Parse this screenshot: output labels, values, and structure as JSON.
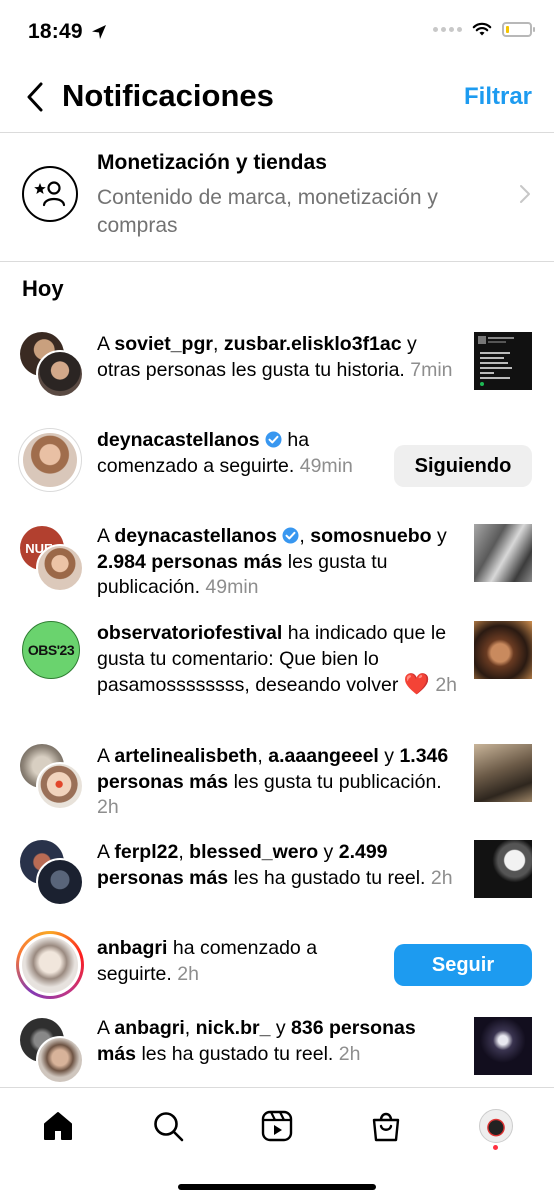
{
  "status": {
    "time": "18:49"
  },
  "header": {
    "title": "Notificaciones",
    "filter_label": "Filtrar"
  },
  "monetization": {
    "title": "Monetización y tiendas",
    "subtitle": "Contenido de marca, monetización y compras"
  },
  "section_today": "Hoy",
  "notifications": [
    {
      "pre": "A ",
      "u1": "soviet_pgr",
      "sep1": ", ",
      "u2": "zusbar.elisklo3f1ac",
      "post": " y otras personas les gusta tu historia.",
      "time": "7min"
    },
    {
      "u1": "deynacastellanos",
      "post": " ha comenzado a seguirte.",
      "time": "49min",
      "button": "Siguiendo"
    },
    {
      "pre": "A ",
      "u1": "deynacastellanos",
      "sep1": ", ",
      "u2": "somosnuebo",
      "sep2": " y ",
      "u3": "2.984 personas más",
      "post": " les gusta tu publicación.",
      "time": "49min",
      "avatar_label": "NUE"
    },
    {
      "u1": "observatoriofestival",
      "post": " ha indicado que le gusta tu comentario: Que bien lo pasamossssssss, deseando volver ",
      "emoji": "❤️",
      "time": "2h",
      "avatar_label": "OBS'23"
    },
    {
      "pre": "A ",
      "u1": "artelinealisbeth",
      "sep1": ", ",
      "u2": "a.aaangeeel",
      "sep2": " y ",
      "u3": "1.346 personas más",
      "post": " les gusta tu publicación.",
      "time": "2h"
    },
    {
      "pre": "A ",
      "u1": "ferpl22",
      "sep1": ", ",
      "u2": "blessed_wero",
      "sep2": " y ",
      "u3": "2.499 personas más",
      "post": " les ha gustado tu reel.",
      "time": "2h"
    },
    {
      "u1": "anbagri",
      "post": " ha comenzado a seguirte.",
      "time": "2h",
      "button": "Seguir"
    },
    {
      "pre": "A ",
      "u1": "anbagri",
      "sep1": ", ",
      "u2": "nick.br_",
      "sep2": " y ",
      "u3": "836 personas más",
      "post": " les ha gustado tu reel.",
      "time": "2h"
    }
  ],
  "tabs": [
    "home-icon",
    "search-icon",
    "reels-icon",
    "shop-icon",
    "profile-avatar"
  ]
}
